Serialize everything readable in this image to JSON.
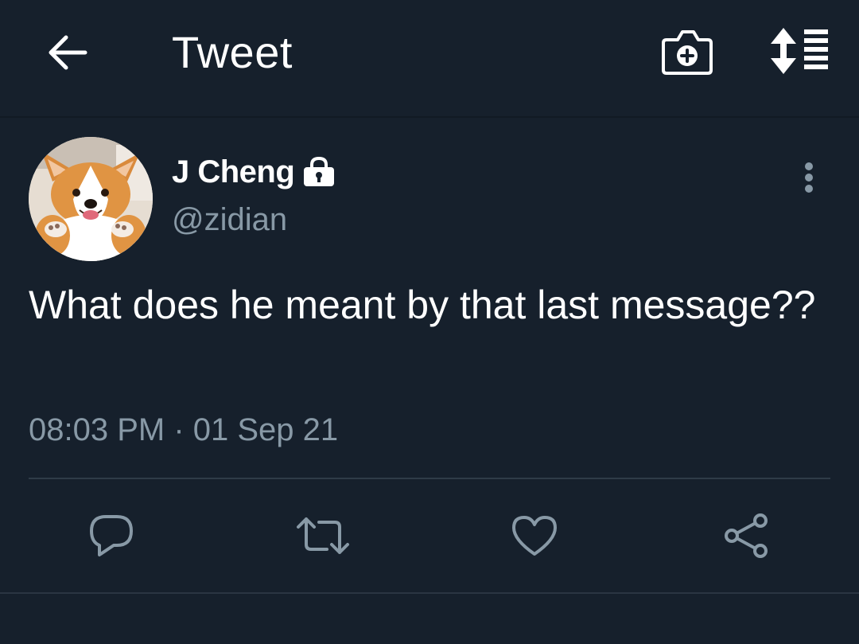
{
  "app_bar": {
    "title": "Tweet",
    "icons": {
      "back": "arrow-left-icon",
      "camera": "camera-plus-icon",
      "sort": "sort-replies-icon"
    }
  },
  "tweet": {
    "author": {
      "name": "J Cheng",
      "handle": "@zidian",
      "protected_icon": "lock-icon",
      "avatar_icon": "corgi-avatar"
    },
    "text": "What does he meant by that last message??",
    "timestamp": "08:03 PM · 01 Sep 21",
    "more_icon": "more-vertical-icon"
  },
  "actions": [
    {
      "name": "reply",
      "icon": "reply-bubble-icon"
    },
    {
      "name": "retweet",
      "icon": "retweet-icon"
    },
    {
      "name": "like",
      "icon": "heart-icon"
    },
    {
      "name": "share",
      "icon": "share-icon"
    }
  ],
  "colors": {
    "background": "#16202c",
    "text_primary": "#ffffff",
    "text_secondary": "#8899a6",
    "icon_muted": "#8899a6",
    "divider": "#2f3b47"
  }
}
